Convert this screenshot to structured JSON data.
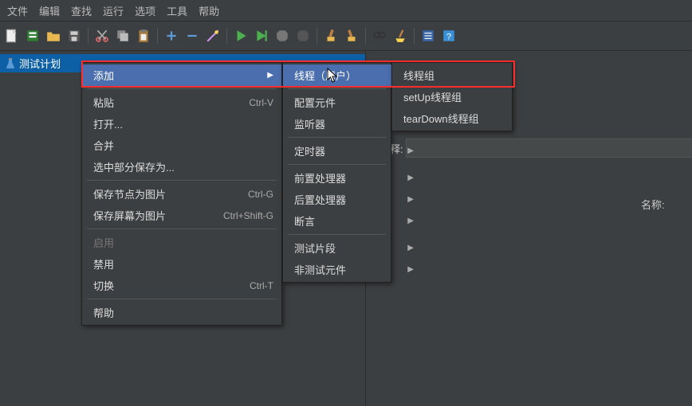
{
  "menubar": [
    "文件",
    "编辑",
    "查找",
    "运行",
    "选项",
    "工具",
    "帮助"
  ],
  "tree": {
    "item": "测试计划"
  },
  "right": {
    "label1": "释:",
    "label2": "名称:"
  },
  "menu1": {
    "items": [
      {
        "label": "添加",
        "arrow": true,
        "hl": true
      },
      {
        "sep": true
      },
      {
        "label": "粘贴",
        "shortcut": "Ctrl-V"
      },
      {
        "label": "打开..."
      },
      {
        "label": "合并"
      },
      {
        "label": "选中部分保存为..."
      },
      {
        "sep": true
      },
      {
        "label": "保存节点为图片",
        "shortcut": "Ctrl-G"
      },
      {
        "label": "保存屏幕为图片",
        "shortcut": "Ctrl+Shift-G"
      },
      {
        "sep": true
      },
      {
        "label": "启用",
        "disabled": true
      },
      {
        "label": "禁用"
      },
      {
        "label": "切换",
        "shortcut": "Ctrl-T"
      },
      {
        "sep": true
      },
      {
        "label": "帮助"
      }
    ]
  },
  "menu2": {
    "items": [
      {
        "label": "线程（用户）",
        "arrow": true,
        "hl": true
      },
      {
        "sep": true
      },
      {
        "label": "配置元件",
        "arrow": true
      },
      {
        "label": "监听器",
        "arrow": true
      },
      {
        "sep": true
      },
      {
        "label": "定时器",
        "arrow": true
      },
      {
        "sep": true
      },
      {
        "label": "前置处理器",
        "arrow": true
      },
      {
        "label": "后置处理器",
        "arrow": true
      },
      {
        "label": "断言",
        "arrow": true
      },
      {
        "sep": true
      },
      {
        "label": "测试片段",
        "arrow": true
      },
      {
        "label": "非测试元件",
        "arrow": true
      }
    ]
  },
  "menu3": {
    "items": [
      {
        "label": "线程组"
      },
      {
        "label": "setUp线程组"
      },
      {
        "label": "tearDown线程组"
      }
    ]
  },
  "toolbar_icons": [
    "new-file",
    "new-template",
    "open",
    "save",
    "cut",
    "copy",
    "paste",
    "plus",
    "minus",
    "wand",
    "run",
    "run-green",
    "stop",
    "stop-all",
    "clear-broom",
    "clear-broom2",
    "search",
    "sweep",
    "report",
    "help"
  ]
}
